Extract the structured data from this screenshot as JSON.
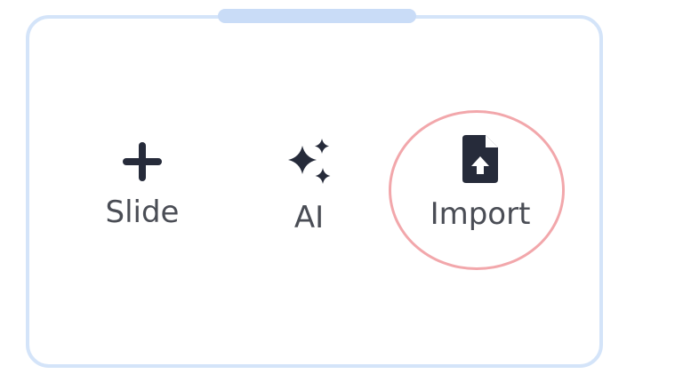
{
  "colors": {
    "panel_border": "#d4e4f9",
    "handle": "#c9dcf7",
    "icon": "#262b3a",
    "label": "#4a4d55",
    "highlight": "#f2a7ab"
  },
  "actions": [
    {
      "label": "Slide",
      "icon": "plus-icon"
    },
    {
      "label": "AI",
      "icon": "sparkles-icon"
    },
    {
      "label": "Import",
      "icon": "file-upload-icon"
    }
  ]
}
